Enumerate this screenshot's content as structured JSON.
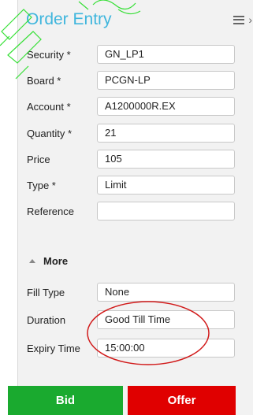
{
  "header": {
    "title": "Order Entry",
    "menu_icon": "hamburger-menu-icon",
    "collapse_icon": "chevron-right-icon"
  },
  "form": {
    "security": {
      "label": "Security *",
      "value": "GN_LP1"
    },
    "board": {
      "label": "Board *",
      "value": "PCGN-LP"
    },
    "account": {
      "label": "Account *",
      "value": "A1200000R.EX"
    },
    "quantity": {
      "label": "Quantity *",
      "value": "21"
    },
    "price": {
      "label": "Price",
      "value": "105"
    },
    "type": {
      "label": "Type *",
      "value": "Limit"
    },
    "reference": {
      "label": "Reference",
      "value": ""
    }
  },
  "more": {
    "label": "More",
    "icon": "triangle-up-icon"
  },
  "advanced": {
    "fill_type": {
      "label": "Fill Type",
      "value": "None"
    },
    "duration": {
      "label": "Duration",
      "value": "Good Till Time"
    },
    "expiry_time": {
      "label": "Expiry Time",
      "value": "15:00:00"
    }
  },
  "actions": {
    "bid_label": "Bid",
    "offer_label": "Offer"
  },
  "colors": {
    "title": "#3fb6dd",
    "bid": "#1aaa2f",
    "offer": "#e00000",
    "annotation": "#d11a1a",
    "watermark": "#22dd22"
  }
}
